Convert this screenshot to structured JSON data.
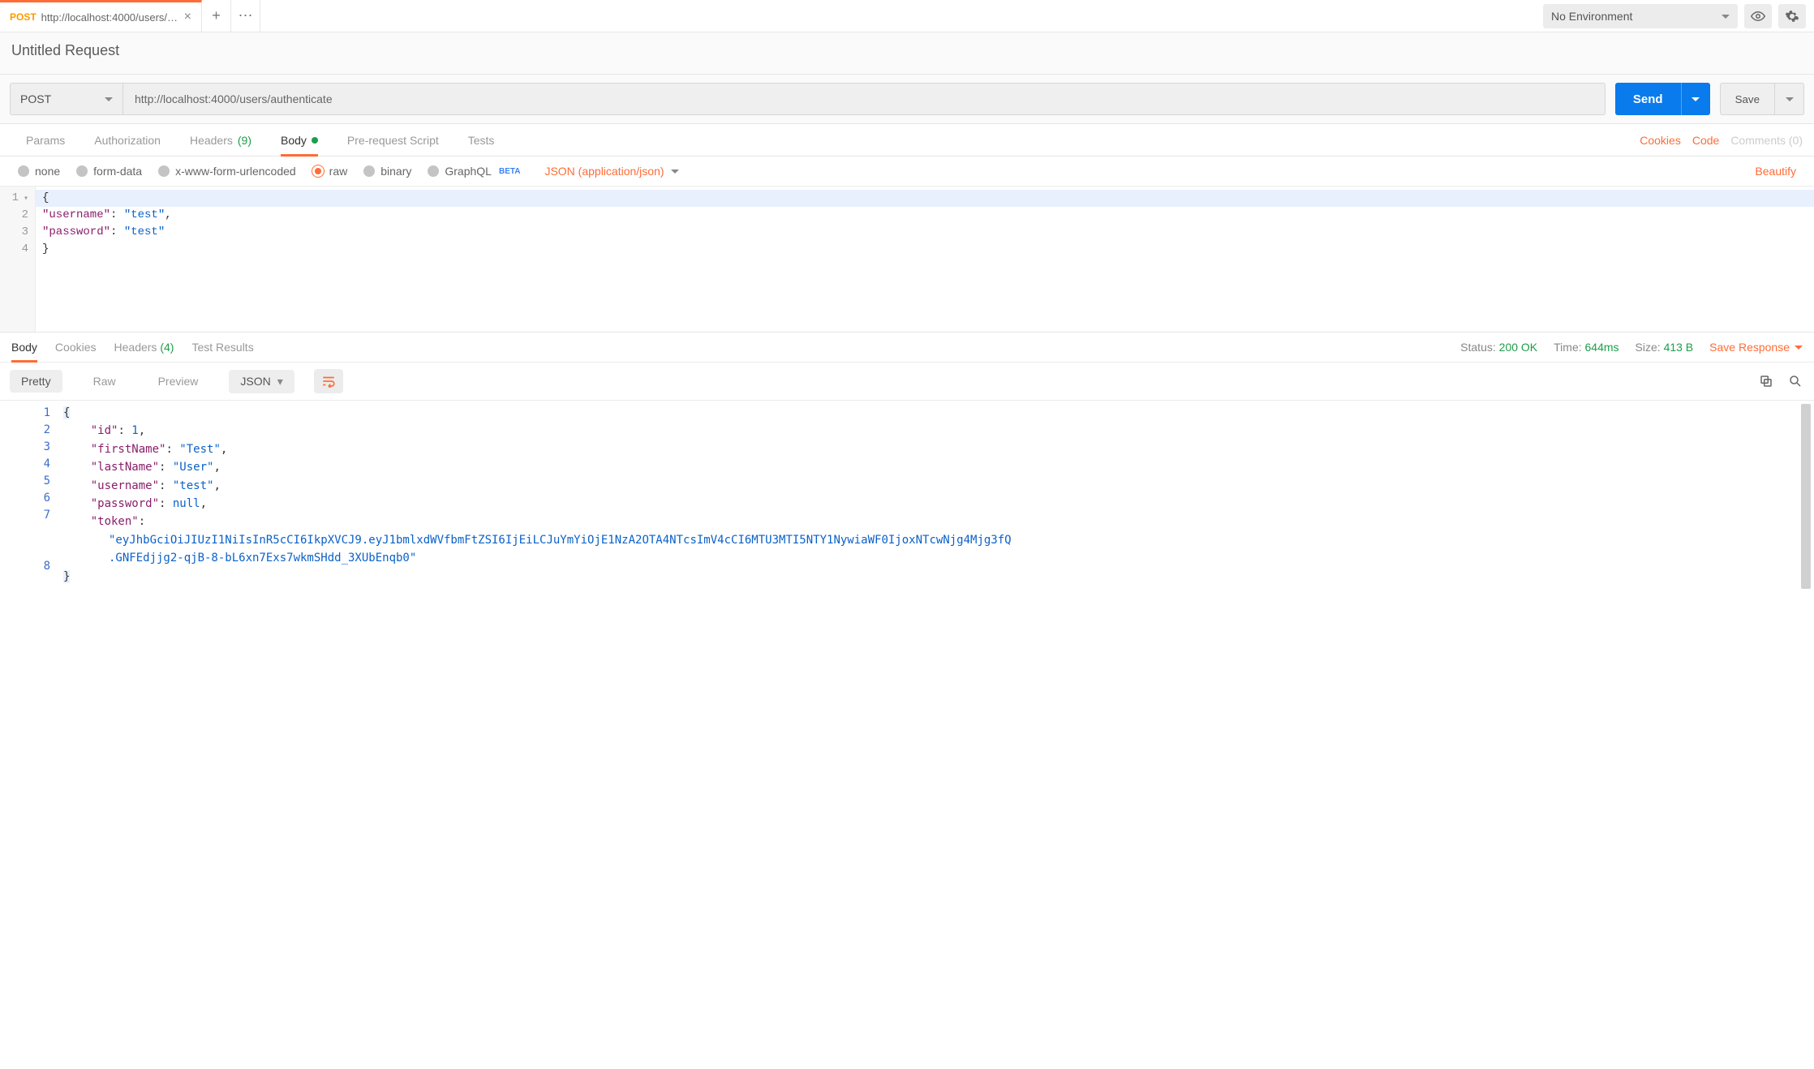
{
  "tabs": {
    "active": {
      "method": "POST",
      "title": "http://localhost:4000/users/a..."
    }
  },
  "env": {
    "label": "No Environment"
  },
  "requestName": "Untitled Request",
  "url": {
    "method": "POST",
    "value": "http://localhost:4000/users/authenticate"
  },
  "buttons": {
    "send": "Send",
    "save": "Save"
  },
  "reqTabs": {
    "params": "Params",
    "auth": "Authorization",
    "headers": "Headers",
    "headersCount": "(9)",
    "body": "Body",
    "prereq": "Pre-request Script",
    "tests": "Tests"
  },
  "reqTabLinks": {
    "cookies": "Cookies",
    "code": "Code",
    "comments": "Comments (0)"
  },
  "bodyTypes": {
    "none": "none",
    "formData": "form-data",
    "xwww": "x-www-form-urlencoded",
    "raw": "raw",
    "binary": "binary",
    "graphql": "GraphQL",
    "beta": "BETA"
  },
  "contentType": "JSON (application/json)",
  "beautify": "Beautify",
  "requestBodyLines": {
    "l1": "{",
    "l2_indent": "    ",
    "l2_key": "\"username\"",
    "l2_colon": ": ",
    "l2_val": "\"test\"",
    "l2_comma": ",",
    "l3_indent": "    ",
    "l3_key": "\"password\"",
    "l3_colon": ": ",
    "l3_val": "\"test\"",
    "l4": "}"
  },
  "requestGutter": [
    "1",
    "2",
    "3",
    "4"
  ],
  "responseTabs": {
    "body": "Body",
    "cookies": "Cookies",
    "headers": "Headers",
    "headersCount": "(4)",
    "tests": "Test Results"
  },
  "responseMeta": {
    "statusLabel": "Status:",
    "statusValue": "200 OK",
    "timeLabel": "Time:",
    "timeValue": "644ms",
    "sizeLabel": "Size:",
    "sizeValue": "413 B",
    "saveResponse": "Save Response"
  },
  "responseToolbar": {
    "pretty": "Pretty",
    "raw": "Raw",
    "preview": "Preview",
    "format": "JSON"
  },
  "responseGutter": [
    "1",
    "2",
    "3",
    "4",
    "5",
    "6",
    "7",
    "8"
  ],
  "responseBody": {
    "open": "{",
    "id_key": "\"id\"",
    "id_val": "1",
    "fn_key": "\"firstName\"",
    "fn_val": "\"Test\"",
    "ln_key": "\"lastName\"",
    "ln_val": "\"User\"",
    "un_key": "\"username\"",
    "un_val": "\"test\"",
    "pw_key": "\"password\"",
    "pw_val": "null",
    "tk_key": "\"token\"",
    "tk_val1": "\"eyJhbGciOiJIUzI1NiIsInR5cCI6IkpXVCJ9.eyJ1bmlxdWVfbmFtZSI6IjEiLCJuYmYiOjE1NzA2OTA4NTcsImV4cCI6MTU3MTI5NTY1NywiaWF0IjoxNTcwNjg4Mjg3fQ",
    "tk_val2": ".GNFEdjjg2-qjB-8-bL6xn7Exs7wkmSHdd_3XUbEnqb0\"",
    "close": "}"
  }
}
